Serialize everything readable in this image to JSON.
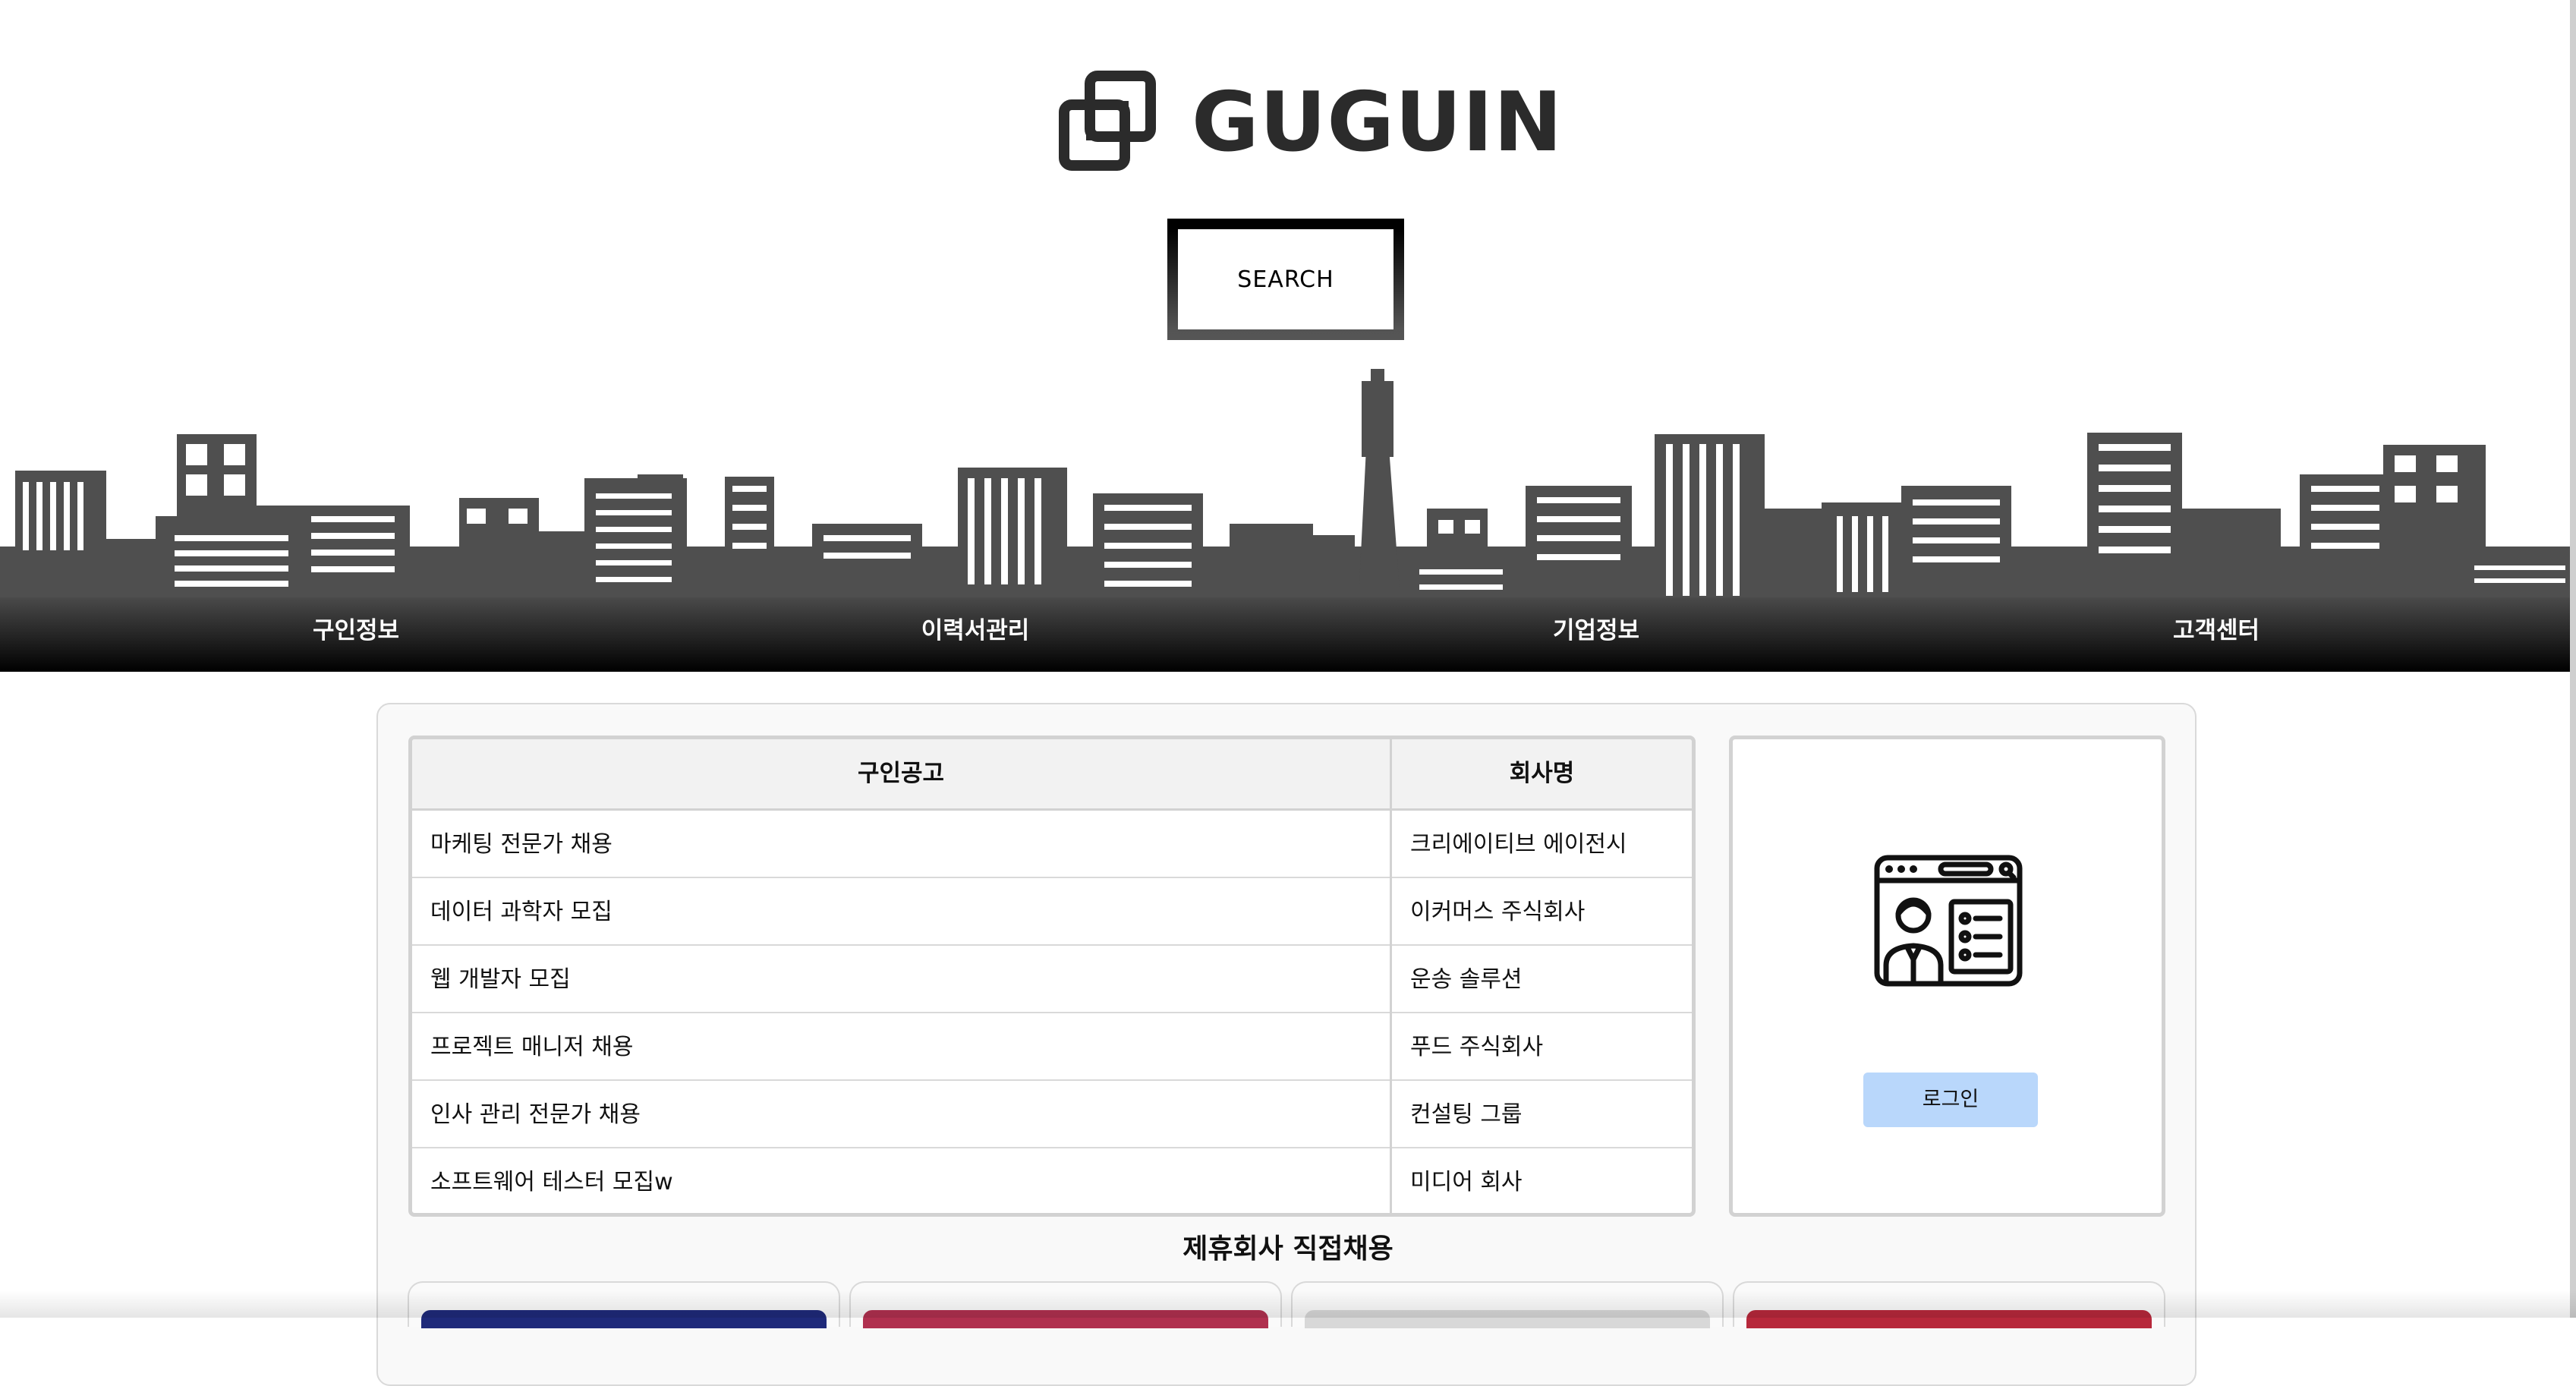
{
  "brand": {
    "name": "GUGUIN",
    "logo_icon": "interlocked-squares-logo"
  },
  "search": {
    "label": "SEARCH"
  },
  "nav": {
    "items": [
      {
        "label": "구인정보"
      },
      {
        "label": "이력서관리"
      },
      {
        "label": "기업정보"
      },
      {
        "label": "고객센터"
      }
    ]
  },
  "jobs_table": {
    "headers": {
      "title": "구인공고",
      "company": "회사명"
    },
    "rows": [
      {
        "title": "마케팅 전문가 채용",
        "company": "크리에이티브 에이전시"
      },
      {
        "title": "데이터 과학자 모집",
        "company": "이커머스 주식회사"
      },
      {
        "title": "웹 개발자 모집",
        "company": "운송 솔루션"
      },
      {
        "title": "프로젝트 매니저 채용",
        "company": "푸드 주식회사"
      },
      {
        "title": "인사 관리 전문가 채용",
        "company": "컨설팅 그룹"
      },
      {
        "title": "소프트웨어 테스터 모집w",
        "company": "미디어 회사"
      }
    ]
  },
  "login_card": {
    "icon": "profile-browser-icon",
    "button_label": "로그인"
  },
  "partners": {
    "title": "제휴회사 직접채용",
    "cards": [
      {
        "color": "#1f2a7a"
      },
      {
        "color": "#b0304f"
      },
      {
        "color": "#d8d8d8"
      },
      {
        "color": "#b7283b"
      }
    ]
  },
  "colors": {
    "navbar": "#000000",
    "skyline": "#4f4f4f",
    "login_button": "#b9d7fb"
  }
}
